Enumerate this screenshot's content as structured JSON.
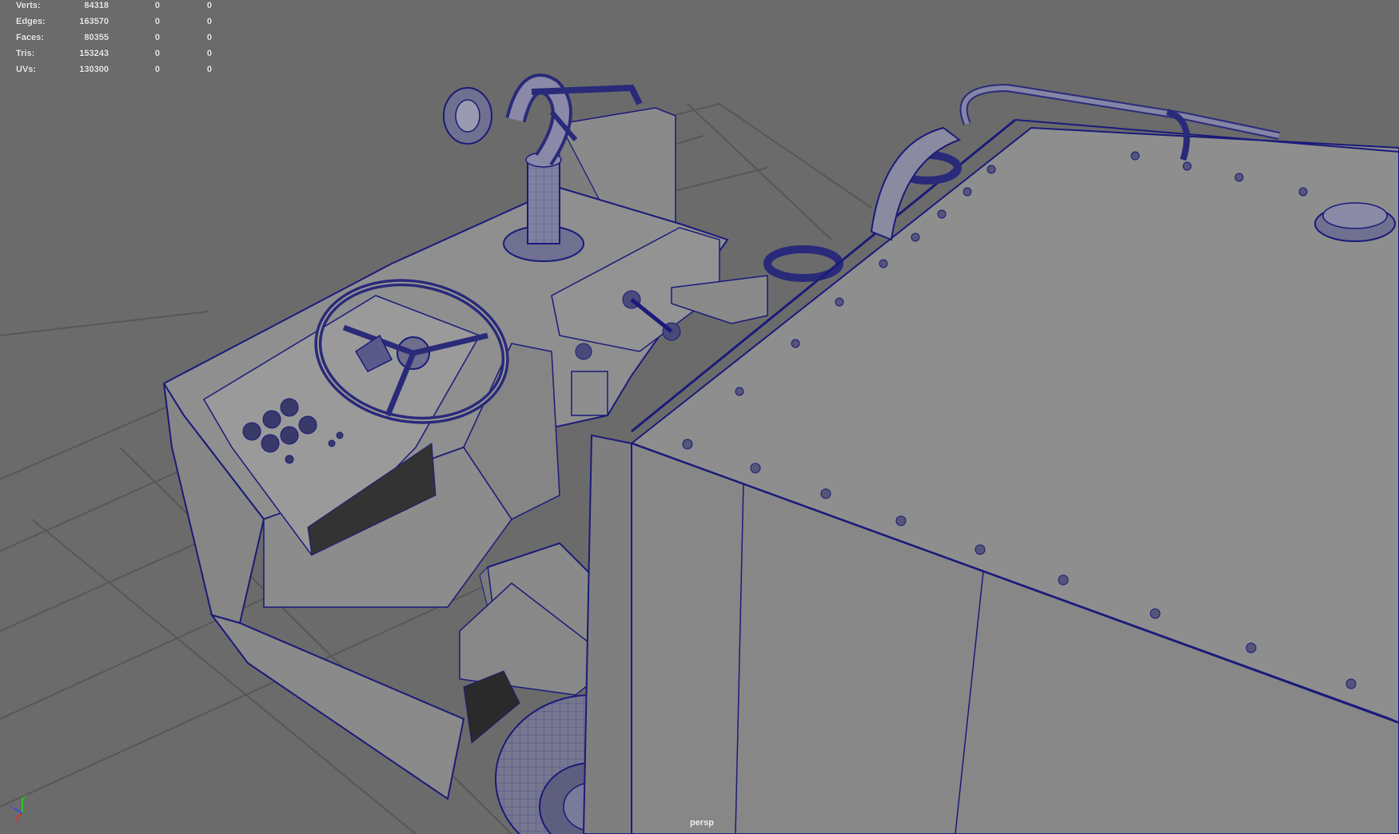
{
  "hud": {
    "rows": [
      {
        "label": "Verts:",
        "v1": "84318",
        "v2": "0",
        "v3": "0"
      },
      {
        "label": "Edges:",
        "v1": "163570",
        "v2": "0",
        "v3": "0"
      },
      {
        "label": "Faces:",
        "v1": "80355",
        "v2": "0",
        "v3": "0"
      },
      {
        "label": "Tris:",
        "v1": "153243",
        "v2": "0",
        "v3": "0"
      },
      {
        "label": "UVs:",
        "v1": "130300",
        "v2": "0",
        "v3": "0"
      }
    ]
  },
  "camera": {
    "label": "persp"
  },
  "axis": {
    "x": "x",
    "y": "y",
    "z": "z"
  },
  "colors": {
    "background": "#6b6b6b",
    "grid": "#575757",
    "mesh_face": "#8e8e8e",
    "wire": "#1a1a7a",
    "hud_text": "#ececec",
    "axis_x": "#d83030",
    "axis_y": "#30c030",
    "axis_z": "#3050e0"
  }
}
